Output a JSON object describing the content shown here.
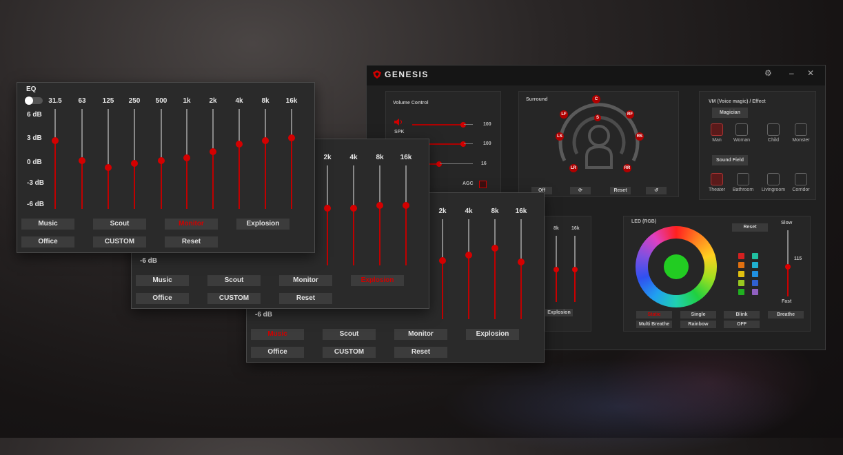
{
  "app": {
    "brand": "GENESIS",
    "controls": {
      "settings": "⚙",
      "minimize": "–",
      "close": "✕"
    },
    "volume": {
      "title": "Volume Control",
      "spk_label": "SPK",
      "val1": "100",
      "val2": "100",
      "val3": "16",
      "agc_label": "AGC",
      "level1": 0.85,
      "level2": 0.85,
      "level3": 0.45
    },
    "surround": {
      "title": "Surround",
      "speakers": [
        "C",
        "LF",
        "RF",
        "S",
        "LS",
        "RS",
        "LR",
        "RR"
      ],
      "buttons": {
        "off": "Off",
        "reset": "Reset"
      }
    },
    "vm": {
      "title": "VM (Voice magic) / Effect",
      "magician": "Magician",
      "voices": [
        "Man",
        "Woman",
        "Child",
        "Monster"
      ],
      "sound_field": "Sound Field",
      "fields": [
        "Theater",
        "Bathroom",
        "Livingroom",
        "Corridor"
      ]
    },
    "partial_eq": {
      "labels": [
        "8k",
        "16k"
      ],
      "explosion": "Explosion"
    },
    "led": {
      "title": "LED (RGB)",
      "reset": "Reset",
      "slow": "Slow",
      "fast": "Fast",
      "speed_value": "115",
      "speed_level": 0.45,
      "modes_row1": [
        "Static",
        "Single",
        "Blink",
        "Breathe"
      ],
      "modes_row2": [
        "Multi Breathe",
        "Rainbow",
        "OFF"
      ],
      "center_color": "#22cc22",
      "swatches_left": [
        "#d42020",
        "#e07010",
        "#e0c010",
        "#98c820",
        "#20b020"
      ],
      "swatches_right": [
        "#20c0a0",
        "#20b0d0",
        "#2090e0",
        "#3060d0",
        "#9060c0"
      ]
    }
  },
  "eq_front": {
    "title": "EQ",
    "freqs": [
      "31.5",
      "63",
      "125",
      "250",
      "500",
      "1k",
      "2k",
      "4k",
      "8k",
      "16k"
    ],
    "db_labels": [
      "6 dB",
      "3 dB",
      "0 dB",
      "-3 dB",
      "-6 dB"
    ],
    "levels_db": [
      2.6,
      -0.1,
      -1.0,
      -0.5,
      -0.1,
      0.3,
      1.1,
      2.1,
      2.6,
      3.0
    ],
    "presets_row1": [
      "Music",
      "Scout",
      "Monitor",
      "Explosion"
    ],
    "presets_row2": [
      "Office",
      "CUSTOM",
      "Reset"
    ],
    "active": "Monitor"
  },
  "eq_mid": {
    "freqs": [
      "2k",
      "4k",
      "8k",
      "16k"
    ],
    "db_label": "-6 dB",
    "levels_db": [
      1.1,
      1.1,
      1.5,
      1.5
    ],
    "presets_row1": [
      "Music",
      "Scout",
      "Monitor",
      "Explosion"
    ],
    "presets_row2": [
      "Office",
      "CUSTOM",
      "Reset"
    ],
    "active": "Explosion"
  },
  "eq_back": {
    "freqs": [
      "2k",
      "4k",
      "8k",
      "16k"
    ],
    "db_label": "-6 dB",
    "levels_db": [
      1.3,
      2.0,
      3.0,
      1.1
    ],
    "presets_row1": [
      "Music",
      "Scout",
      "Monitor",
      "Explosion"
    ],
    "presets_row2": [
      "Office",
      "CUSTOM",
      "Reset"
    ],
    "active": "Music"
  }
}
